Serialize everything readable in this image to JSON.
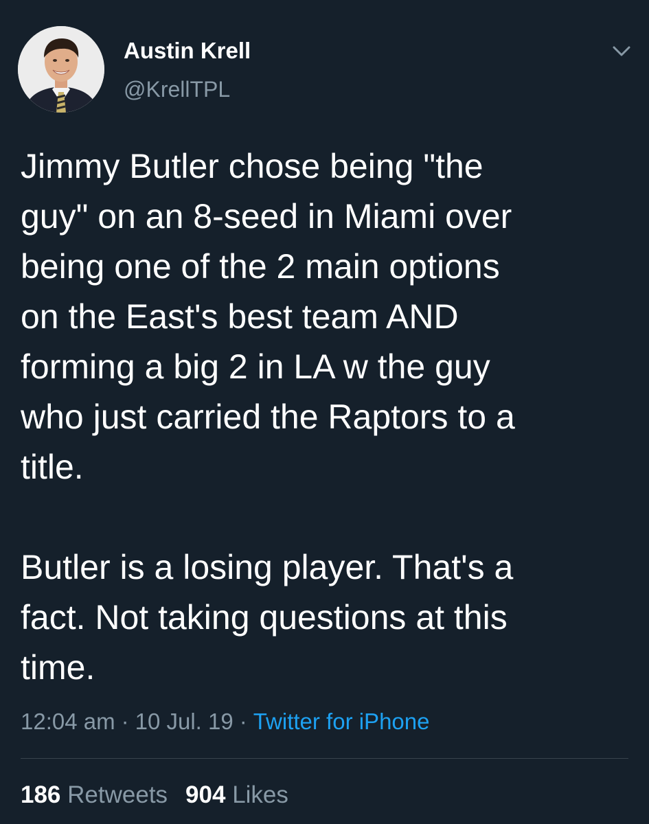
{
  "user": {
    "name": "Austin Krell",
    "handle": "@KrellTPL"
  },
  "tweet": {
    "text": "Jimmy Butler chose being \"the\nguy\" on an 8-seed in Miami over\nbeing one of the 2 main options\non the East's best team AND\nforming a big 2 in LA w the guy\nwho just carried the Raptors to a\ntitle.\n\nButler is a losing player. That's a\nfact. Not taking questions at this\ntime.",
    "time": "12:04 am",
    "date": "10 Jul. 19",
    "separator": "·",
    "source": "Twitter for iPhone"
  },
  "stats": {
    "retweets_count": "186",
    "retweets_label": "Retweets",
    "likes_count": "904",
    "likes_label": "Likes"
  },
  "icons": {
    "caret": "chevron-down-icon",
    "avatar": "avatar"
  },
  "colors": {
    "background": "#15202b",
    "primary_text": "#ffffff",
    "secondary_text": "#8899a6",
    "link": "#1da1f2",
    "divider": "#38444d"
  }
}
